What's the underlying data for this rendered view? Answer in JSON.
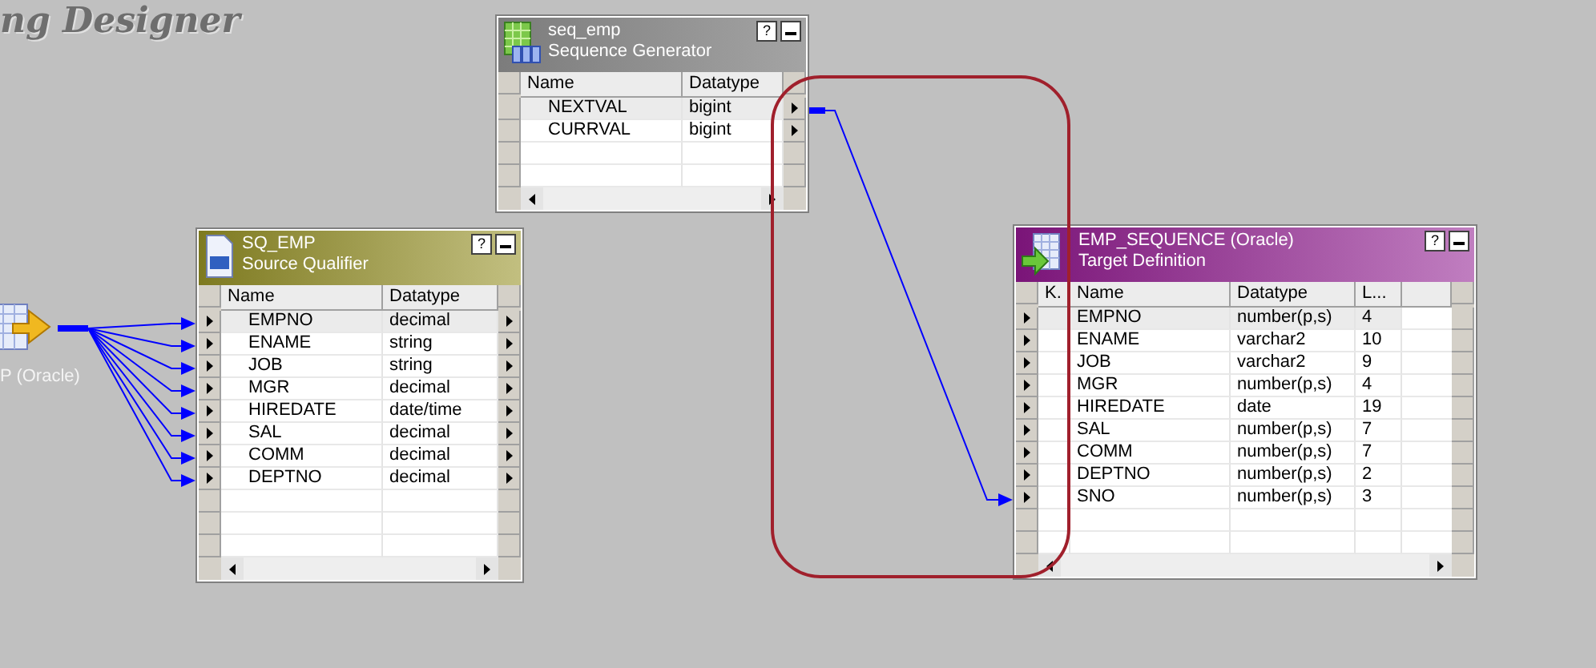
{
  "canvas_title": "ng Designer",
  "source": {
    "label": "P (Oracle)"
  },
  "transformations": [
    {
      "kind": "sequence",
      "name": "seq_emp",
      "type": "Sequence Generator",
      "help": "?",
      "columns": [
        "Name",
        "Datatype"
      ],
      "rows": [
        {
          "cells": [
            "NEXTVAL",
            "bigint"
          ],
          "selected": true
        },
        {
          "cells": [
            "CURRVAL",
            "bigint"
          ],
          "selected": false
        }
      ]
    },
    {
      "kind": "qualifier",
      "name": "SQ_EMP",
      "type": "Source Qualifier",
      "help": "?",
      "columns": [
        "Name",
        "Datatype"
      ],
      "rows": [
        {
          "cells": [
            "EMPNO",
            "decimal"
          ],
          "selected": true
        },
        {
          "cells": [
            "ENAME",
            "string"
          ],
          "selected": false
        },
        {
          "cells": [
            "JOB",
            "string"
          ],
          "selected": false
        },
        {
          "cells": [
            "MGR",
            "decimal"
          ],
          "selected": false
        },
        {
          "cells": [
            "HIREDATE",
            "date/time"
          ],
          "selected": false
        },
        {
          "cells": [
            "SAL",
            "decimal"
          ],
          "selected": false
        },
        {
          "cells": [
            "COMM",
            "decimal"
          ],
          "selected": false
        },
        {
          "cells": [
            "DEPTNO",
            "decimal"
          ],
          "selected": false
        }
      ]
    },
    {
      "kind": "target",
      "name": "EMP_SEQUENCE (Oracle)",
      "type": "Target Definition",
      "help": "?",
      "columns": [
        "K.",
        "Name",
        "Datatype",
        "L..."
      ],
      "rows": [
        {
          "cells": [
            "",
            "EMPNO",
            "number(p,s)",
            "4"
          ],
          "selected": true
        },
        {
          "cells": [
            "",
            "ENAME",
            "varchar2",
            "10"
          ],
          "selected": false
        },
        {
          "cells": [
            "",
            "JOB",
            "varchar2",
            "9"
          ],
          "selected": false
        },
        {
          "cells": [
            "",
            "MGR",
            "number(p,s)",
            "4"
          ],
          "selected": false
        },
        {
          "cells": [
            "",
            "HIREDATE",
            "date",
            "19"
          ],
          "selected": false
        },
        {
          "cells": [
            "",
            "SAL",
            "number(p,s)",
            "7"
          ],
          "selected": false
        },
        {
          "cells": [
            "",
            "COMM",
            "number(p,s)",
            "7"
          ],
          "selected": false
        },
        {
          "cells": [
            "",
            "DEPTNO",
            "number(p,s)",
            "2"
          ],
          "selected": false
        },
        {
          "cells": [
            "",
            "SNO",
            "number(p,s)",
            "3"
          ],
          "selected": false
        }
      ]
    }
  ]
}
